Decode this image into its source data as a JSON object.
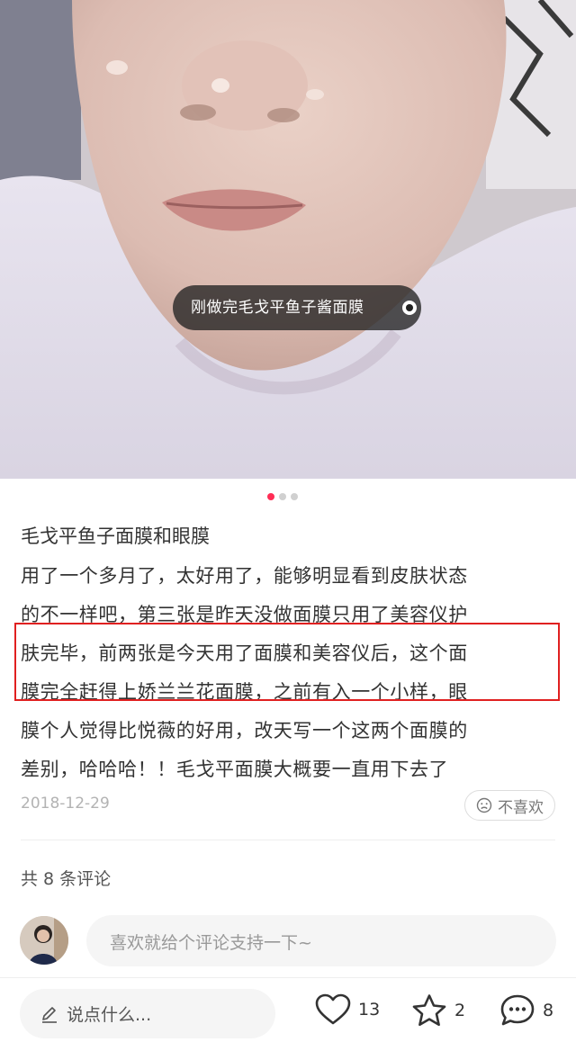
{
  "photo": {
    "tag_text": "刚做完毛戈平鱼子酱面膜"
  },
  "carousel": {
    "count": 3,
    "active": 0
  },
  "post": {
    "title": "毛戈平鱼子面膜和眼膜",
    "body_lines": [
      "用了一个多月了，太好用了，能够明显看到皮肤状态",
      "的不一样吧，第三张是昨天没做面膜只用了美容仪护",
      "肤完毕，前两张是今天用了面膜和美容仪后，这个面",
      "膜完全赶得上娇兰兰花面膜，之前有入一个小样，眼",
      "膜个人觉得比悦薇的好用，改天写一个这两个面膜的",
      "差别，哈哈哈！！毛戈平面膜大概要一直用下去了"
    ],
    "date": "2018-12-29",
    "dislike_label": "不喜欢"
  },
  "comments": {
    "count_label": "共 8 条评论",
    "input_placeholder": "喜欢就给个评论支持一下~"
  },
  "bottom_bar": {
    "say_placeholder": "说点什么...",
    "likes": "13",
    "stars": "2",
    "comments": "8"
  },
  "colors": {
    "accent": "#ff2d55",
    "highlight_border": "#e02020"
  }
}
